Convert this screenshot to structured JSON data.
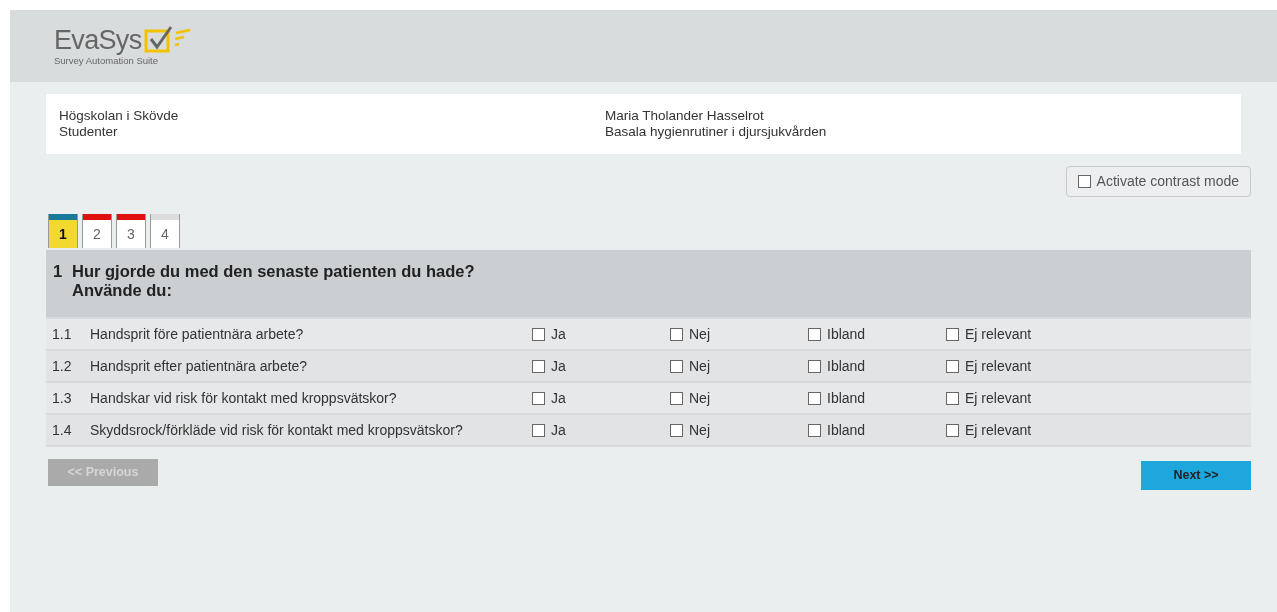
{
  "logo": {
    "name": "EvaSys",
    "tagline": "Survey Automation Suite"
  },
  "info": {
    "left": [
      "Högskolan i Skövde",
      "Studenter"
    ],
    "right": [
      "Maria Tholander Hasselrot",
      "Basala hygienrutiner i djursjukvården"
    ]
  },
  "contrast_mode": {
    "label": "Activate contrast mode",
    "checked": false
  },
  "tabs": [
    {
      "label": "1",
      "selected": true,
      "color": "#1a7a9a"
    },
    {
      "label": "2",
      "selected": false,
      "color": "#e01010"
    },
    {
      "label": "3",
      "selected": false,
      "color": "#e01010"
    },
    {
      "label": "4",
      "selected": false,
      "color": "#dcdcdc"
    }
  ],
  "section": {
    "number": "1",
    "title": [
      "Hur gjorde du med den senaste patienten du hade?",
      "Använde du:"
    ]
  },
  "questions": [
    {
      "number": "1.1",
      "text": "Handsprit före patientnära arbete?",
      "options": [
        {
          "label": "Ja",
          "checked": false
        },
        {
          "label": "Nej",
          "checked": false
        },
        {
          "label": "Ibland",
          "checked": false
        },
        {
          "label": "Ej relevant",
          "checked": false
        }
      ]
    },
    {
      "number": "1.2",
      "text": "Handsprit efter patientnära arbete?",
      "options": [
        {
          "label": "Ja",
          "checked": false
        },
        {
          "label": "Nej",
          "checked": false
        },
        {
          "label": "Ibland",
          "checked": false
        },
        {
          "label": "Ej relevant",
          "checked": false
        }
      ]
    },
    {
      "number": "1.3",
      "text": "Handskar vid risk för kontakt med kroppsvätskor?",
      "options": [
        {
          "label": "Ja",
          "checked": false
        },
        {
          "label": "Nej",
          "checked": false
        },
        {
          "label": "Ibland",
          "checked": false
        },
        {
          "label": "Ej relevant",
          "checked": false
        }
      ]
    },
    {
      "number": "1.4",
      "text": "Skyddsrock/förkläde vid risk för kontakt med kroppsvätskor?",
      "options": [
        {
          "label": "Ja",
          "checked": false
        },
        {
          "label": "Nej",
          "checked": false
        },
        {
          "label": "Ibland",
          "checked": false
        },
        {
          "label": "Ej relevant",
          "checked": false
        }
      ]
    }
  ],
  "buttons": {
    "previous": {
      "label": "<< Previous",
      "disabled": true
    },
    "next": {
      "label": "Next >>",
      "disabled": false
    }
  }
}
